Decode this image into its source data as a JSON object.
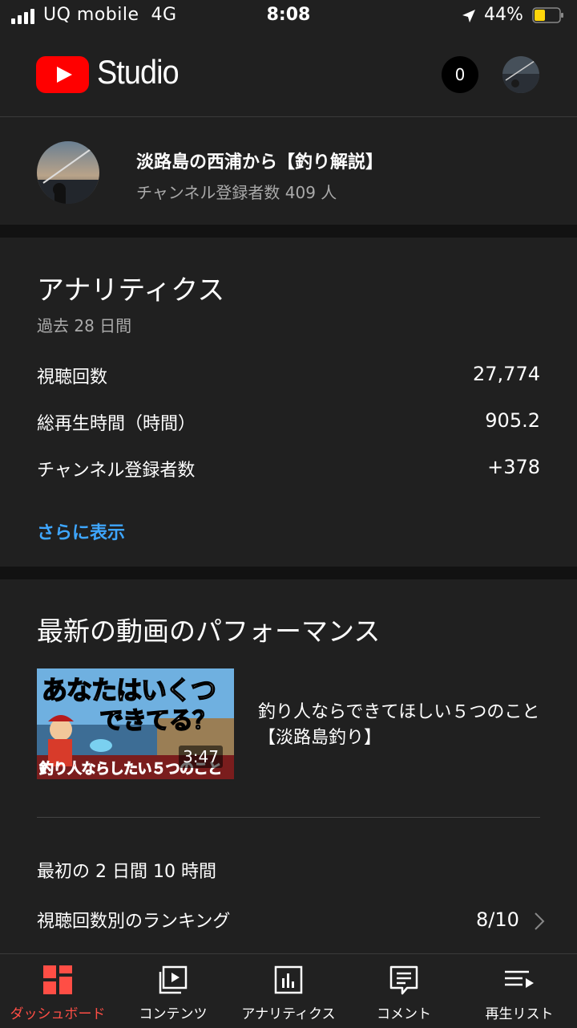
{
  "status_bar": {
    "carrier": "UQ mobile",
    "network": "4G",
    "time": "8:08",
    "battery_percent": "44%",
    "battery_level": 0.44,
    "icons": [
      "signal-icon",
      "location-arrow-icon",
      "battery-icon"
    ]
  },
  "header": {
    "logo_text": "Studio",
    "notification_count": "0",
    "icons": [
      "youtube-logo-icon",
      "avatar"
    ]
  },
  "channel": {
    "name": "淡路島の西浦から【釣り解説】",
    "subscribers": "チャンネル登録者数 409 人"
  },
  "analytics": {
    "title": "アナリティクス",
    "period": "過去 28 日間",
    "rows": [
      {
        "label": "視聴回数",
        "value": "27,774"
      },
      {
        "label": "総再生時間（時間）",
        "value": "905.2"
      },
      {
        "label": "チャンネル登録者数",
        "value": "+378"
      }
    ],
    "more_link": "さらに表示"
  },
  "latest_video": {
    "section_title": "最新の動画のパフォーマンス",
    "thumbnail": {
      "line1": "あなたはいくつ",
      "line2": "できてる？",
      "banner": "釣り人ならしたい５つのこと",
      "duration": "3:47"
    },
    "title": "釣り人ならできてほしい５つのこと【淡路島釣り】",
    "first_period": "最初の 2 日間 10 時間",
    "ranking_label": "視聴回数別のランキング",
    "ranking_value": "8/10"
  },
  "bottom_nav": {
    "accent_color": "#ff4e45",
    "items": [
      {
        "label": "ダッシュボード",
        "icon": "dashboard-icon",
        "active": true
      },
      {
        "label": "コンテンツ",
        "icon": "video-library-icon",
        "active": false
      },
      {
        "label": "アナリティクス",
        "icon": "analytics-icon",
        "active": false
      },
      {
        "label": "コメント",
        "icon": "comment-icon",
        "active": false
      },
      {
        "label": "再生リスト",
        "icon": "playlist-icon",
        "active": false
      }
    ]
  }
}
